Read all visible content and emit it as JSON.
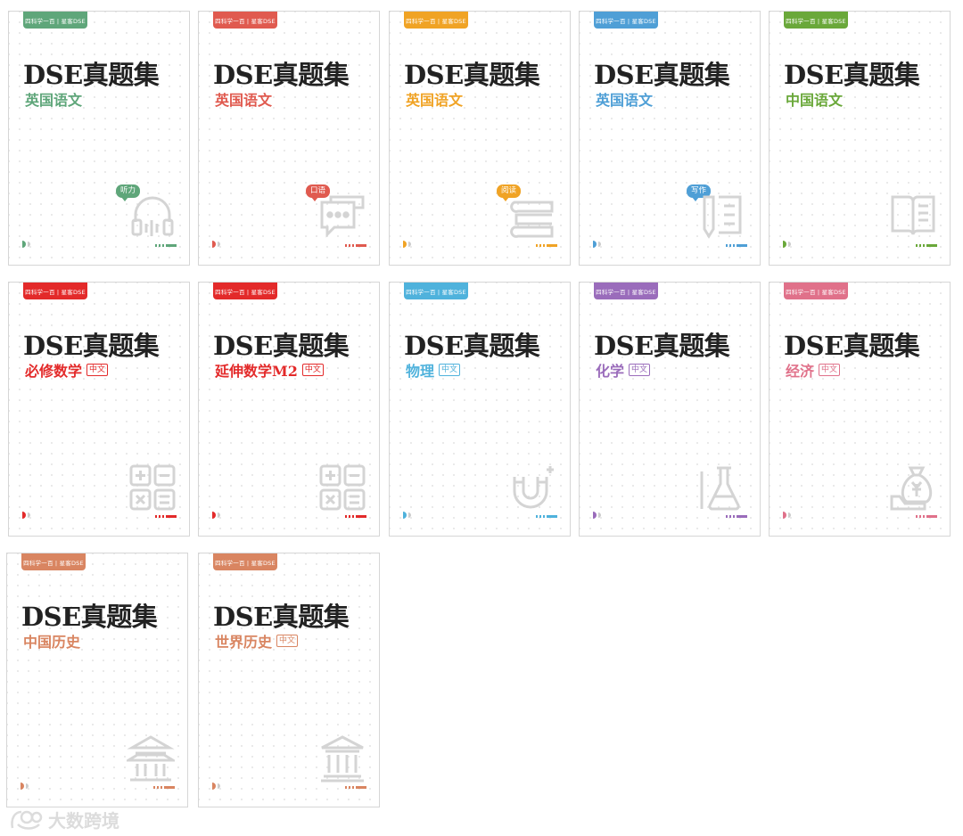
{
  "series_title": "DSE真题集",
  "tab_label": "四科学一百 | 星客DSE",
  "cards": [
    {
      "subject": "英国语文",
      "bubble": "听力",
      "badge": "",
      "color": "#5fa67a",
      "icon": "headphones-icon"
    },
    {
      "subject": "英国语文",
      "bubble": "口语",
      "badge": "",
      "color": "#e05a4f",
      "icon": "chat-icon"
    },
    {
      "subject": "英国语文",
      "bubble": "阅读",
      "badge": "",
      "color": "#f0a325",
      "icon": "book-stack-icon"
    },
    {
      "subject": "英国语文",
      "bubble": "写作",
      "badge": "",
      "color": "#4f9fd6",
      "icon": "writing-icon"
    },
    {
      "subject": "中国语文",
      "bubble": "",
      "badge": "",
      "color": "#6aa83a",
      "icon": "open-book-icon"
    },
    {
      "subject": "必修数学",
      "bubble": "",
      "badge": "中文",
      "color": "#e32a2a",
      "icon": "calculator-icon"
    },
    {
      "subject": "延伸数学M2",
      "bubble": "",
      "badge": "中文",
      "color": "#e32a2a",
      "icon": "calculator-icon"
    },
    {
      "subject": "物理",
      "bubble": "",
      "badge": "中文",
      "color": "#4fb2dc",
      "icon": "magnet-icon"
    },
    {
      "subject": "化学",
      "bubble": "",
      "badge": "中文",
      "color": "#9a6cbb",
      "icon": "flask-icon"
    },
    {
      "subject": "经济",
      "bubble": "",
      "badge": "中文",
      "color": "#e0718a",
      "icon": "money-bag-icon"
    },
    {
      "subject": "中国历史",
      "bubble": "",
      "badge": "",
      "color": "#d98561",
      "icon": "pavilion-icon"
    },
    {
      "subject": "世界历史",
      "bubble": "",
      "badge": "中文",
      "color": "#d98561",
      "icon": "museum-icon"
    }
  ],
  "watermark": "大数跨境"
}
